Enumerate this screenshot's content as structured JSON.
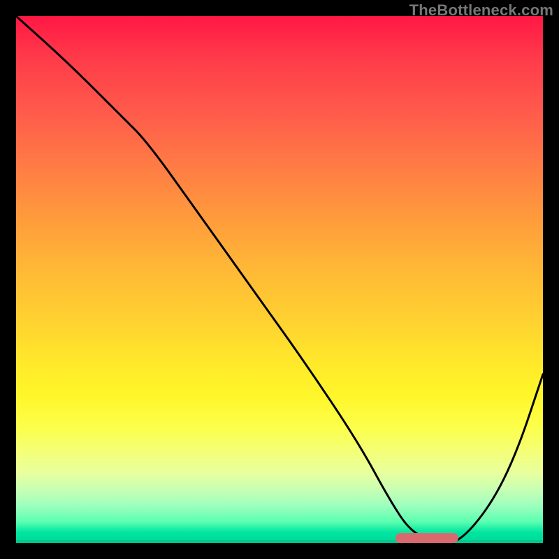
{
  "watermark": "TheBottleneck.com",
  "chart_data": {
    "type": "line",
    "title": "",
    "xlabel": "",
    "ylabel": "",
    "xlim": [
      0,
      100
    ],
    "ylim": [
      0,
      100
    ],
    "x": [
      0,
      10,
      20,
      25,
      35,
      45,
      55,
      65,
      71,
      75,
      80,
      84,
      90,
      95,
      100
    ],
    "values": [
      100,
      91,
      81,
      76,
      62,
      48,
      34,
      19,
      8,
      2,
      0,
      0,
      7,
      17,
      32
    ],
    "marker_x_range": [
      72,
      84
    ],
    "marker_y": 0,
    "gradient_stops": [
      {
        "pos": 0.0,
        "color": "#ff1744"
      },
      {
        "pos": 0.35,
        "color": "#ff8a40"
      },
      {
        "pos": 0.65,
        "color": "#ffe52a"
      },
      {
        "pos": 0.85,
        "color": "#eaff90"
      },
      {
        "pos": 1.0,
        "color": "#00d898"
      }
    ]
  }
}
